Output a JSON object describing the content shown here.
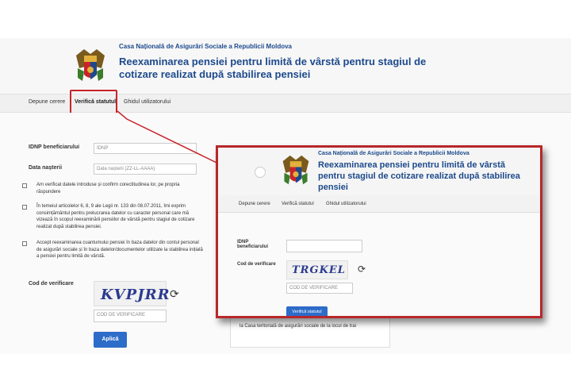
{
  "header": {
    "agency": "Casa Națională de Asigurări Sociale a Republicii Moldova",
    "title_line1": "Reexaminarea pensiei pentru limită de vârstă pentru stagiul de",
    "title_line2": "cotizare realizat după stabilirea pensiei"
  },
  "nav": {
    "items": [
      "Depune cerere",
      "Verifică statutul",
      "Ghidul utilizatorului"
    ]
  },
  "form": {
    "idnp_label": "IDNP beneficiarului",
    "idnp_placeholder": "IDNP",
    "birth_label": "Data nașterii",
    "birth_placeholder": "Data nașterii (ZZ-LL-AAAA)",
    "check1_line1": "Am verificat datele introduse și confirm corectitudinea lor, pe propria",
    "check1_line2": "răspundere",
    "check2_line1": "În temeiul articolelor 6, 8, 9 ale Legii nr. 133 din 08.07.2011, îmi exprim",
    "check2_line2": "consimțământul pentru prelucrarea datelor cu caracter personal care mă",
    "check2_line3": "vizează în scopul reexaminării pensiilor de vârstă pentru stagiul de cotizare",
    "check2_line4": "realizat după stabilirea pensiei.",
    "check3_line1": "Accept reexaminarea cuantumului pensiei în baza datelor din contul personal",
    "check3_line2": "de asigurări sociale și în baza datelor/documentelor utilizate la stabilirea inițială",
    "check3_line3": "a pensiei pentru limită de vârstă.",
    "captcha_label": "Cod de verificare",
    "captcha_text": "KVPJRR",
    "captcha_placeholder": "COD DE VERIFICARE",
    "submit_label": "Aplică"
  },
  "side": {
    "text": "la Casa teritorială de asigurări sociale de la locul de trai"
  },
  "overlay": {
    "agency": "Casa Națională de Asigurări Sociale a Republicii Moldova",
    "title_line1": "Reexaminarea pensiei pentru limită de vârstă",
    "title_line2": "pentru stagiul de cotizare realizat după stabilirea",
    "title_line3": "pensiei",
    "nav": [
      "Depune cerere",
      "Verifică statutul",
      "Ghidul utilizatorului"
    ],
    "idnp_label_line1": "IDNP",
    "idnp_label_line2": "beneficiarului",
    "captcha_label": "Cod de verificare",
    "captcha_text": "TRGKEL",
    "captcha_placeholder": "COD DE VERIFICARE",
    "button_label": "Verifică statutul"
  },
  "colors": {
    "brand_blue": "#1d4a8c",
    "button_blue": "#2d6cc8",
    "highlight_red": "#c8232a"
  }
}
